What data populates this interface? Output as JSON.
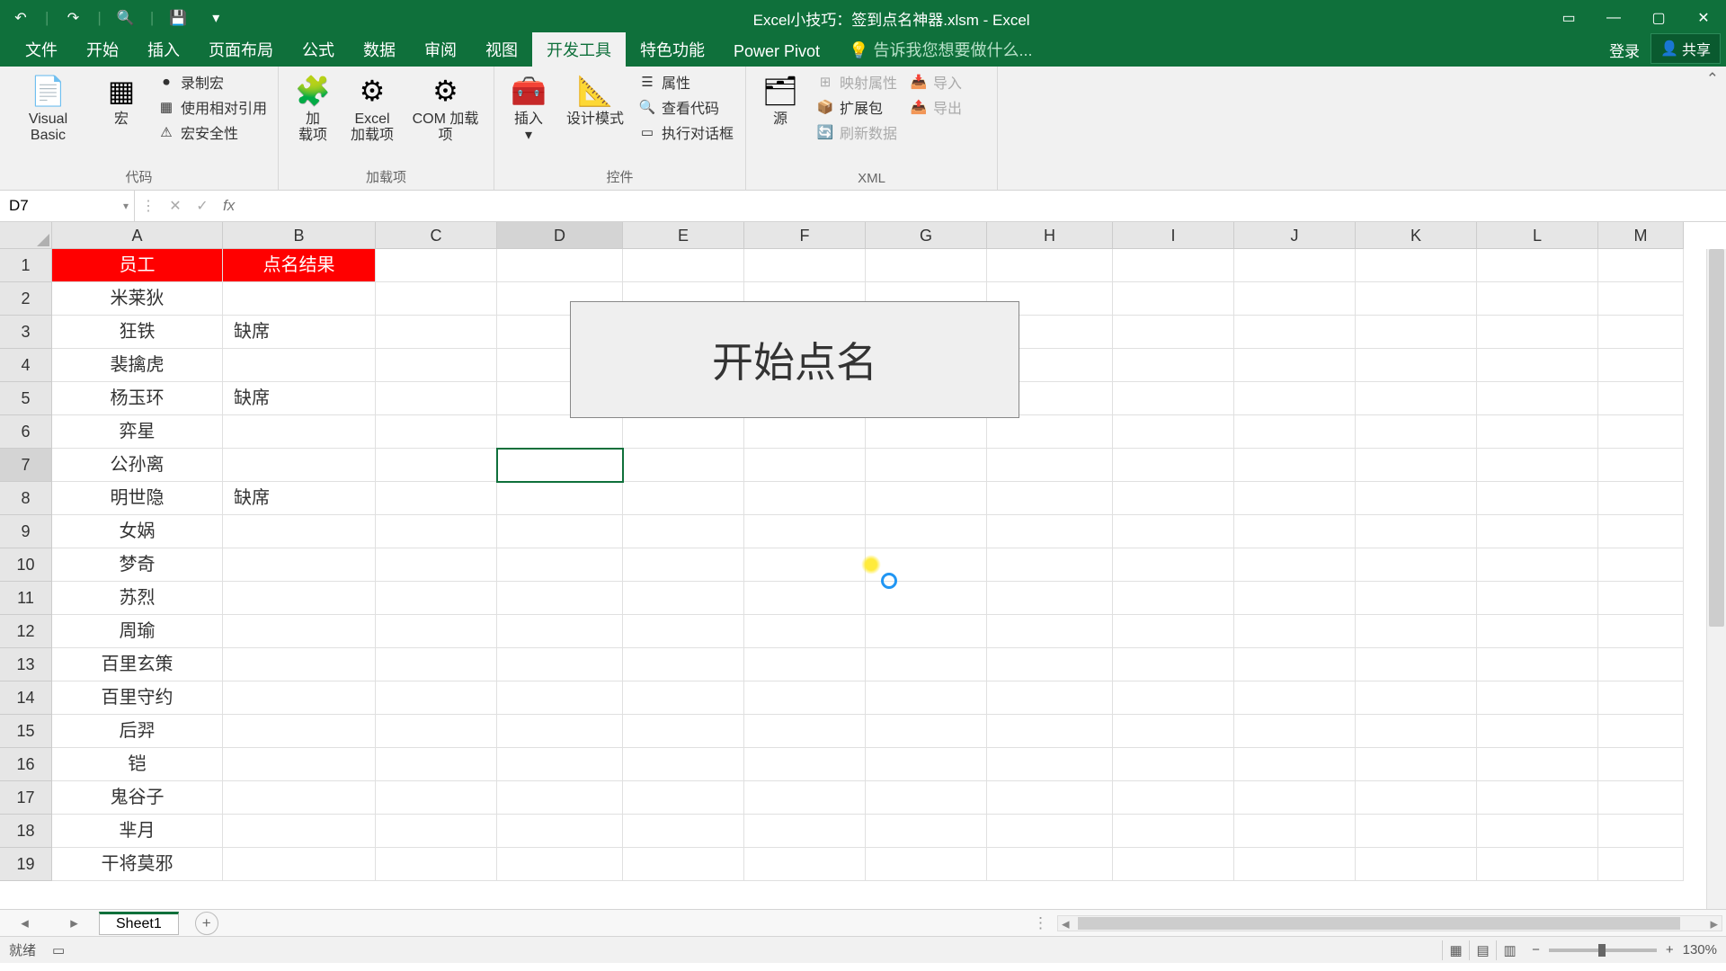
{
  "title": "Excel小技巧：签到点名神器.xlsm - Excel",
  "qat": {
    "undo": "↶",
    "redo": "↷",
    "preview": "🔍",
    "save": "💾",
    "more": "▾"
  },
  "tabs": [
    "文件",
    "开始",
    "插入",
    "页面布局",
    "公式",
    "数据",
    "审阅",
    "视图",
    "开发工具",
    "特色功能",
    "Power Pivot"
  ],
  "active_tab": "开发工具",
  "tell_me": "告诉我您想要做什么...",
  "login": "登录",
  "share": "共享",
  "ribbon": {
    "code": {
      "label": "代码",
      "vb": "Visual Basic",
      "macro": "宏",
      "record": "录制宏",
      "useref": "使用相对引用",
      "security": "宏安全性"
    },
    "addins": {
      "label": "加载项",
      "addin": "加\n载项",
      "excel": "Excel\n加载项",
      "com": "COM 加载项"
    },
    "controls": {
      "label": "控件",
      "insert": "插入",
      "design": "设计模式",
      "props": "属性",
      "viewcode": "查看代码",
      "rundlg": "执行对话框"
    },
    "xml": {
      "label": "XML",
      "source": "源",
      "mapprops": "映射属性",
      "expansion": "扩展包",
      "refresh": "刷新数据",
      "import": "导入",
      "export": "导出"
    }
  },
  "namebox": "D7",
  "formula": "",
  "columns": [
    "A",
    "B",
    "C",
    "D",
    "E",
    "F",
    "G",
    "H",
    "I",
    "J",
    "K",
    "L",
    "M"
  ],
  "rows_count": 19,
  "selected_row": 7,
  "selected_col": "D",
  "header_row": {
    "A": "员工",
    "B": "点名结果"
  },
  "data_rows": [
    {
      "A": "米莱狄",
      "B": ""
    },
    {
      "A": "狂铁",
      "B": "缺席"
    },
    {
      "A": "裴擒虎",
      "B": ""
    },
    {
      "A": "杨玉环",
      "B": "缺席"
    },
    {
      "A": "弈星",
      "B": ""
    },
    {
      "A": "公孙离",
      "B": ""
    },
    {
      "A": "明世隐",
      "B": "缺席"
    },
    {
      "A": "女娲",
      "B": ""
    },
    {
      "A": "梦奇",
      "B": ""
    },
    {
      "A": "苏烈",
      "B": ""
    },
    {
      "A": "周瑜",
      "B": ""
    },
    {
      "A": "百里玄策",
      "B": ""
    },
    {
      "A": "百里守约",
      "B": ""
    },
    {
      "A": "后羿",
      "B": ""
    },
    {
      "A": "铠",
      "B": ""
    },
    {
      "A": "鬼谷子",
      "B": ""
    },
    {
      "A": "芈月",
      "B": ""
    },
    {
      "A": "干将莫邪",
      "B": ""
    }
  ],
  "macro_button": "开始点名",
  "sheet": "Sheet1",
  "status": "就绪",
  "zoom": "130%"
}
